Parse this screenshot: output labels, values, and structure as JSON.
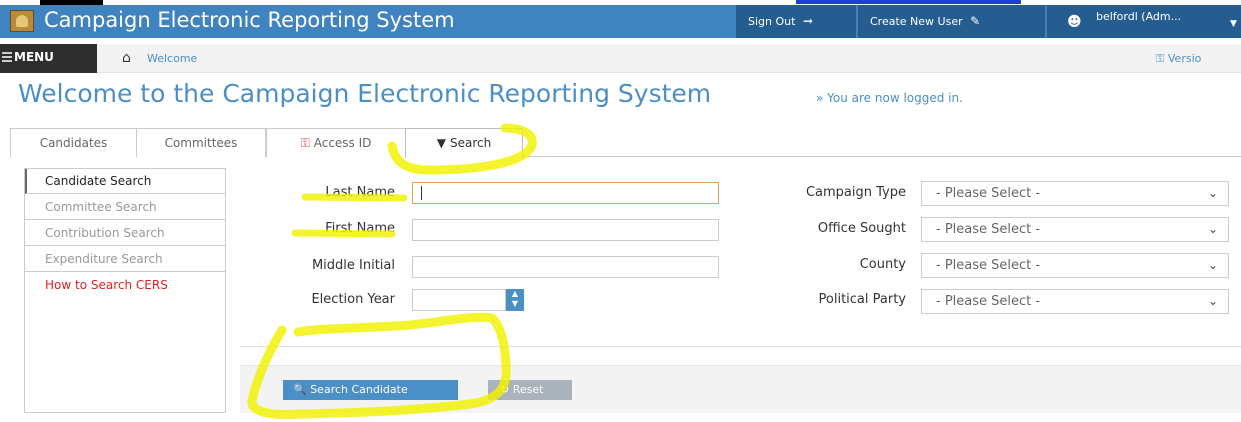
{
  "header": {
    "title": "Campaign Electronic Reporting System",
    "sign_out": "Sign Out",
    "create_user": "Create New User",
    "user": "belfordl (Adm..."
  },
  "breadcrumb": {
    "menu": "MENU",
    "current": "Welcome",
    "version": "Versio"
  },
  "page": {
    "title": "Welcome to the Campaign Electronic Reporting System",
    "subtitle": "» You are now logged in."
  },
  "tabs": [
    {
      "label": "Candidates"
    },
    {
      "label": "Committees"
    },
    {
      "label": "Access ID"
    },
    {
      "label": "Search",
      "active": true
    }
  ],
  "sidebar": {
    "items": [
      {
        "label": "Candidate Search",
        "active": true
      },
      {
        "label": "Committee Search"
      },
      {
        "label": "Contribution Search"
      },
      {
        "label": "Expenditure Search"
      },
      {
        "label": "How to Search CERS"
      }
    ]
  },
  "form": {
    "last_name": {
      "label": "Last Name",
      "value": ""
    },
    "first_name": {
      "label": "First Name",
      "value": ""
    },
    "middle_initial": {
      "label": "Middle Initial",
      "value": ""
    },
    "election_year": {
      "label": "Election Year",
      "value": ""
    },
    "campaign_type": {
      "label": "Campaign Type",
      "selected": "- Please Select -"
    },
    "office_sought": {
      "label": "Office Sought",
      "selected": "- Please Select -"
    },
    "county": {
      "label": "County",
      "selected": "- Please Select -"
    },
    "political_party": {
      "label": "Political Party",
      "selected": "- Please Select -"
    }
  },
  "actions": {
    "search": "Search Candidate",
    "reset": "Reset"
  },
  "colors": {
    "header_blue": "#3f83c0",
    "header_dark": "#265d90",
    "link_blue": "#4d8ec5",
    "highlight": "#f2f200",
    "nav_red": "#dd2222"
  }
}
